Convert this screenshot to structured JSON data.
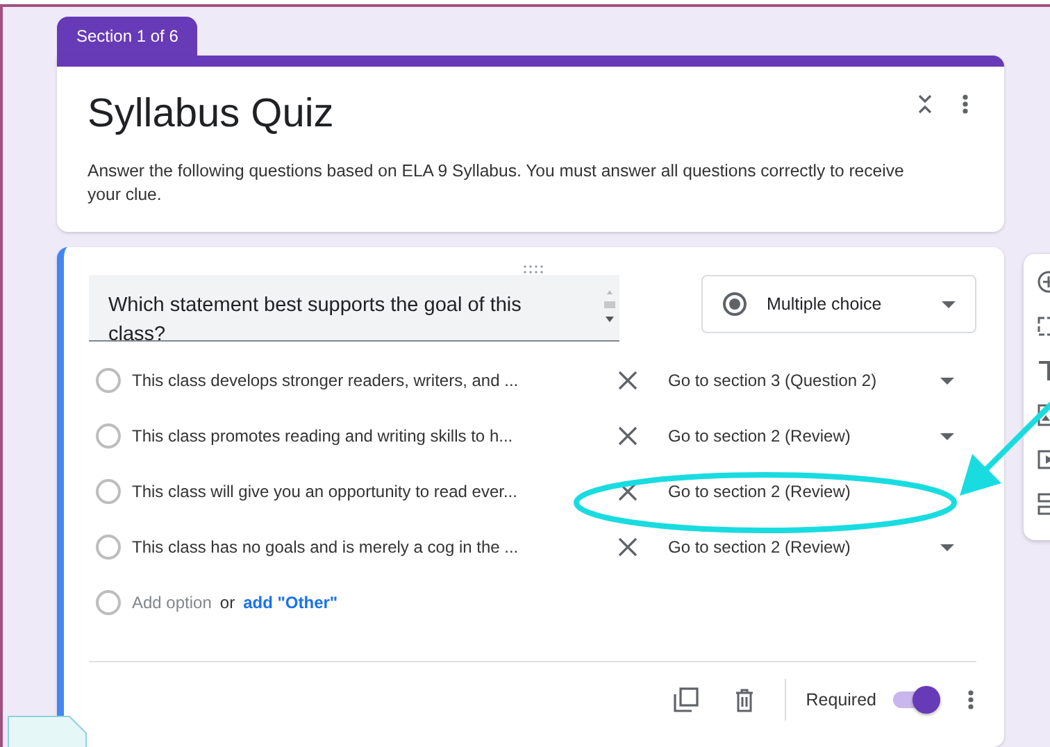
{
  "section_tab": {
    "label": "Section 1 of 6"
  },
  "header": {
    "title": "Syllabus Quiz",
    "description": "Answer the following questions based on ELA 9 Syllabus. You must answer all questions correctly to receive your clue."
  },
  "question": {
    "text": "Which statement best supports the goal of this class?",
    "type": "Multiple choice",
    "options": [
      {
        "text": "This class develops stronger readers, writers, and ...",
        "goto": "Go to section 3 (Question 2)",
        "dropdown_arrow": true,
        "selected": false
      },
      {
        "text": "This class promotes reading and writing skills to h...",
        "goto": "Go to section 2 (Review)",
        "dropdown_arrow": true,
        "selected": false
      },
      {
        "text": "This class will give you an opportunity to read ever...",
        "goto": "Go to section 2 (Review)",
        "dropdown_arrow": false,
        "selected": false
      },
      {
        "text": "This class has no goals and is merely a cog in the ...",
        "goto": "Go to section 2 (Review)",
        "dropdown_arrow": true,
        "selected": false
      }
    ],
    "add_option": {
      "selected": false,
      "placeholder": "Add option",
      "or": "or",
      "other_link": "add \"Other\""
    },
    "required": {
      "label": "Required",
      "on": true
    }
  }
}
